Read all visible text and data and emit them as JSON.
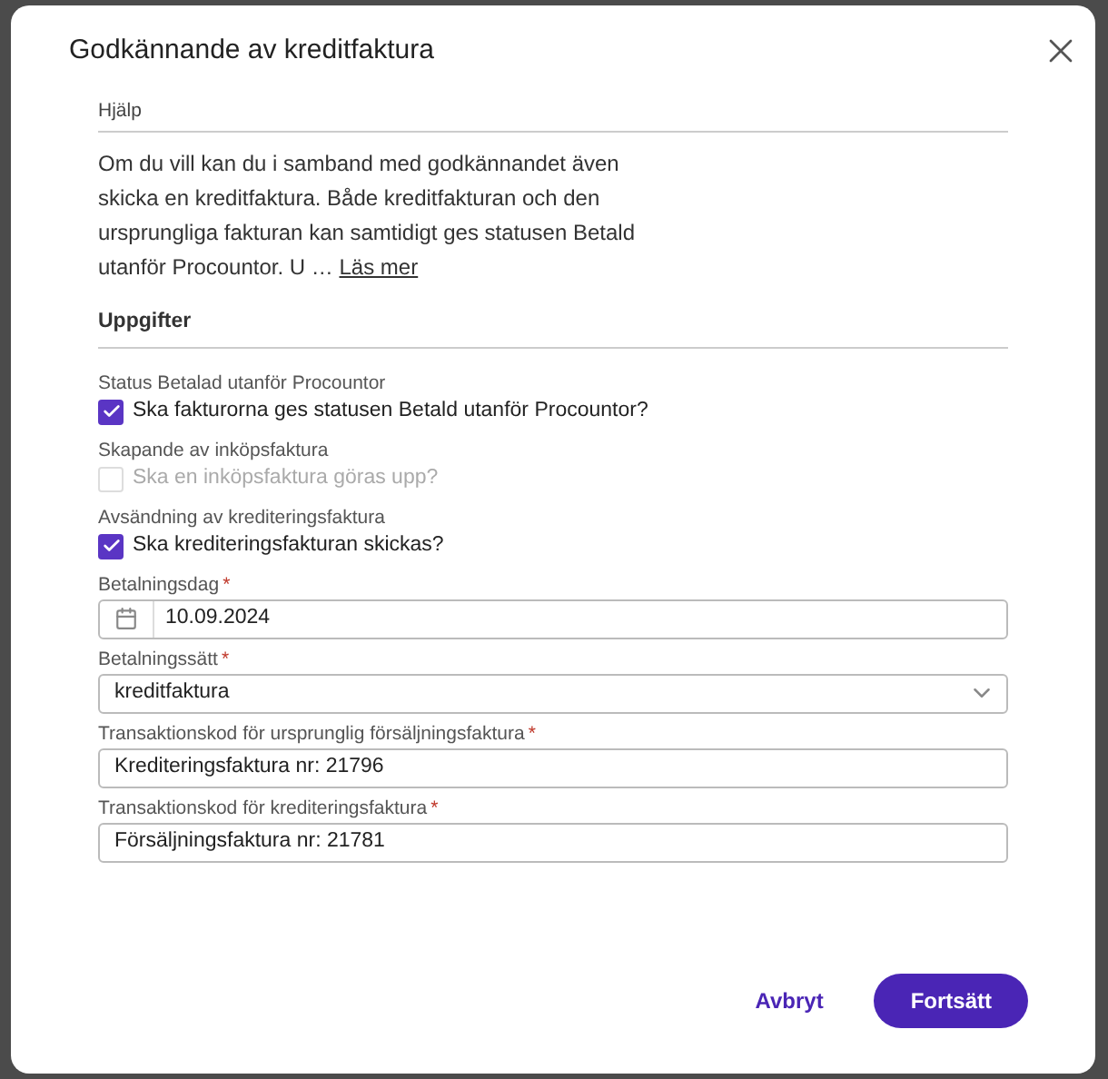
{
  "dialog": {
    "title": "Godkännande av kreditfaktura"
  },
  "help": {
    "heading": "Hjälp",
    "text": "Om du vill kan du i samband med godkännandet även skicka en kreditfaktura. Både kreditfakturan och den ursprungliga fakturan kan samtidigt ges statusen Betald utanför Procountor. U …",
    "link": "Läs mer"
  },
  "tasks": {
    "heading": "Uppgifter",
    "options": [
      {
        "label": "Status Betalad utanför Procountor",
        "text": "Ska fakturorna ges statusen Betald utanför Procountor?",
        "checked": true,
        "disabled": false
      },
      {
        "label": "Skapande av inköpsfaktura",
        "text": "Ska en inköpsfaktura göras upp?",
        "checked": false,
        "disabled": true
      },
      {
        "label": "Avsändning av krediteringsfaktura",
        "text": "Ska krediteringsfakturan skickas?",
        "checked": true,
        "disabled": false
      }
    ]
  },
  "fields": [
    {
      "kind": "date",
      "label": "Betalningsdag",
      "required_mark": "*",
      "value": "10.09.2024"
    },
    {
      "kind": "select",
      "label": "Betalningssätt",
      "required_mark": "*",
      "value": "kreditfaktura"
    },
    {
      "kind": "text",
      "label": "Transaktionskod för ursprunglig försäljningsfaktura",
      "required_mark": "*",
      "value": "Krediteringsfaktura nr: 21796"
    },
    {
      "kind": "text",
      "label": "Transaktionskod för krediteringsfaktura",
      "required_mark": "*",
      "value": "Försäljningsfaktura nr: 21781"
    }
  ],
  "buttons": [
    {
      "label": "Avbryt",
      "kind": "secondary"
    },
    {
      "label": "Fortsätt",
      "kind": "primary"
    }
  ]
}
